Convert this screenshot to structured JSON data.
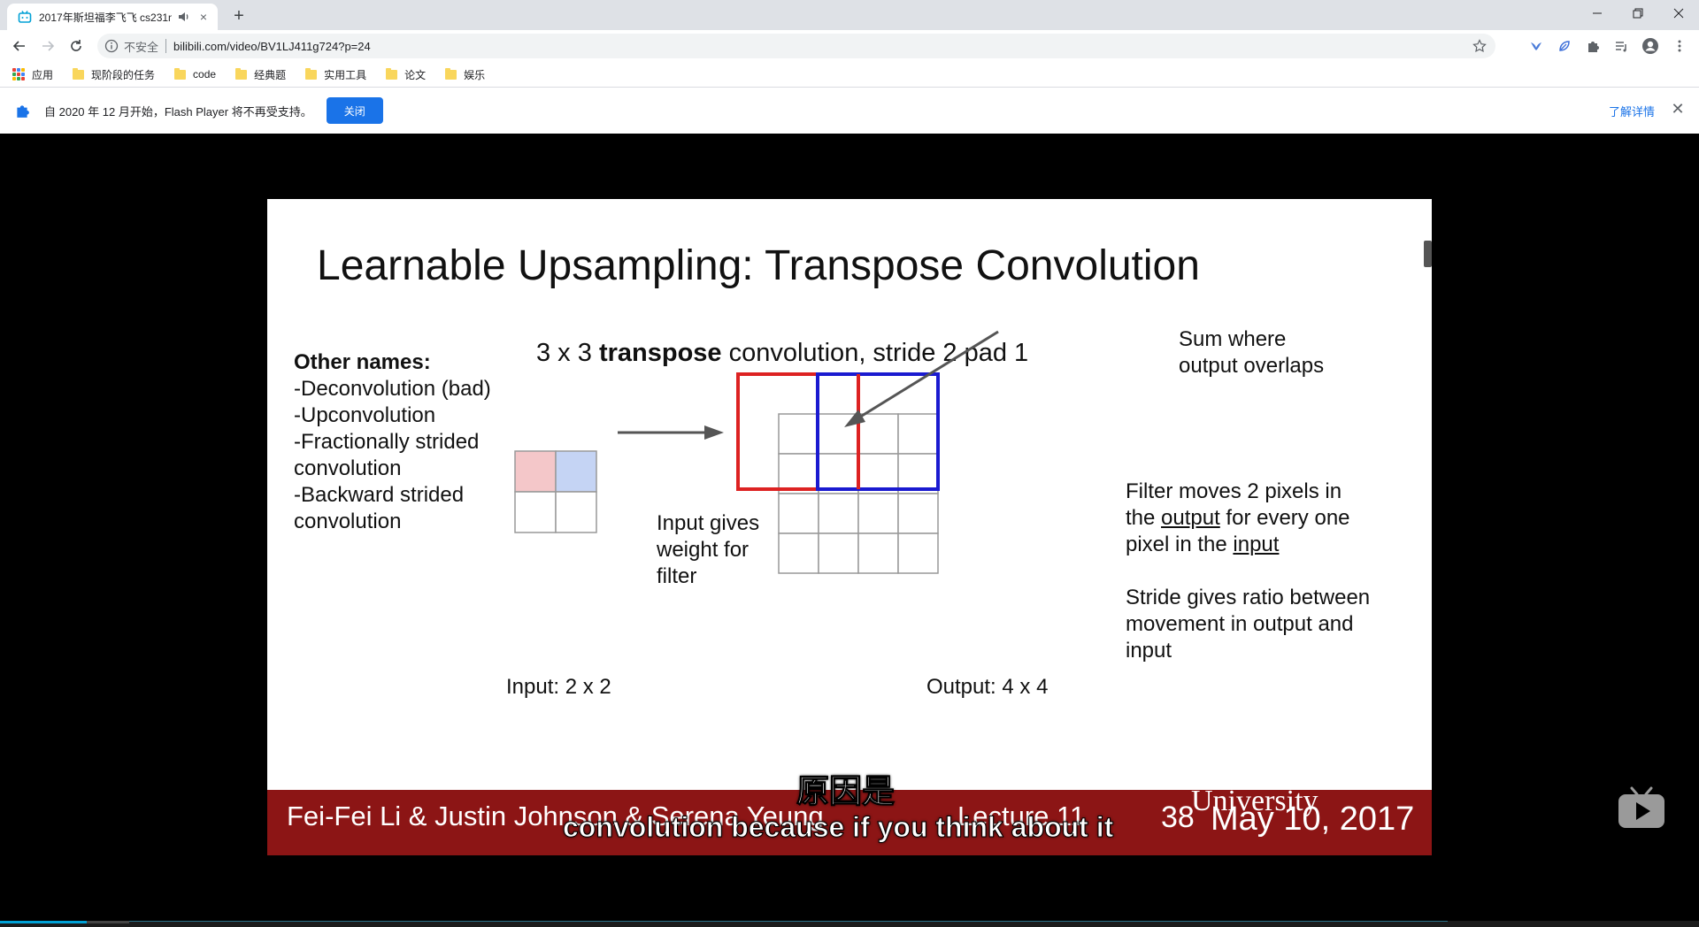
{
  "tab": {
    "title": "2017年斯坦福李飞飞 cs231n",
    "close_symbol": "×"
  },
  "newtab_symbol": "+",
  "window": {
    "minimize_icon": "minimize-icon",
    "restore_icon": "restore-icon",
    "close_icon": "window-close-icon"
  },
  "address": {
    "security": "不安全",
    "url": "bilibili.com/video/BV1LJ411g724?p=24"
  },
  "bookmarks": {
    "apps_label": "应用",
    "items": [
      "现阶段的任务",
      "code",
      "经典题",
      "实用工具",
      "论文",
      "娱乐"
    ]
  },
  "infobar": {
    "message": "自 2020 年 12 月开始，Flash Player 将不再受支持。",
    "close_button": "关闭",
    "learn_more": "了解详情",
    "dismiss_symbol": "✕"
  },
  "slide": {
    "title": "Learnable Upsampling: Transpose Convolution",
    "subtitle_pre": "3 x 3 ",
    "subtitle_bold": "transpose",
    "subtitle_post": " convolution, stride 2 pad 1",
    "other_names_heading": "Other names:",
    "other_names": [
      "-Deconvolution (bad)",
      "-Upconvolution",
      "-Fractionally strided",
      "convolution",
      "-Backward strided",
      "convolution"
    ],
    "sum_lines": [
      "Sum where",
      "output overlaps"
    ],
    "input_gives_lines": [
      "Input gives",
      "weight for",
      "filter"
    ],
    "filter_moves": {
      "line1": "Filter moves 2 pixels in",
      "line2_pre": "the ",
      "line2_u": "output",
      "line2_post": " for every one",
      "line3_pre": "pixel in the ",
      "line3_u": "input"
    },
    "stride_lines": [
      "Stride gives ratio between",
      "movement in output and",
      "input"
    ],
    "input_label": "Input: 2 x 2",
    "output_label": "Output: 4 x 4",
    "footer": {
      "authors": "Fei-Fei Li & Justin Johnson & Serena Yeung",
      "lecture": "Lecture 11",
      "page": "38",
      "date": "May 10, 2017",
      "university": "University"
    }
  },
  "subtitles": {
    "chinese": "原因是",
    "english": "convolution because if you think about it"
  },
  "colors": {
    "accent_blue": "#1a73e8",
    "stanford_red": "#8c1515",
    "cell_pink": "#f4c7c9",
    "cell_blue": "#c5d4f4",
    "filter_red": "#dd2222",
    "filter_blue": "#1a1ad0",
    "bilibili_blue": "#00a1d6"
  }
}
